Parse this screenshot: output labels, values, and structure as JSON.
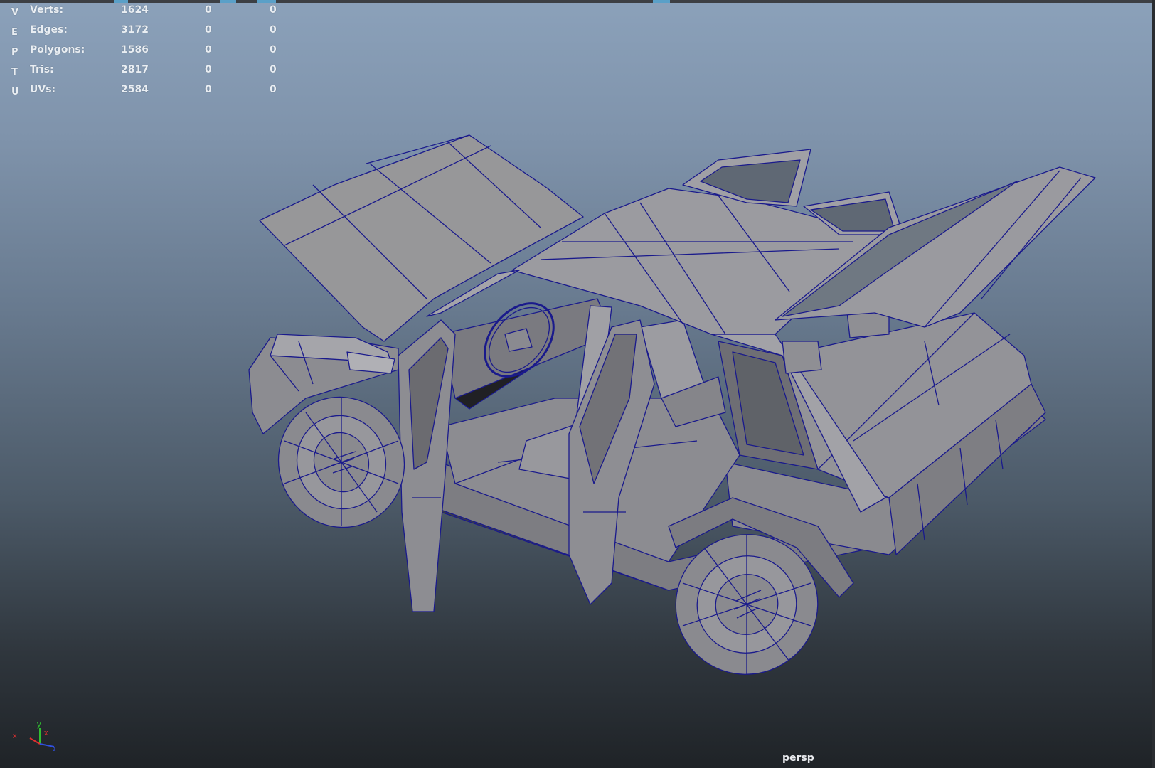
{
  "hud": {
    "rows": [
      {
        "key": "V",
        "label": "Verts:",
        "total": "1624",
        "selected": "0",
        "component": "0"
      },
      {
        "key": "E",
        "label": "Edges:",
        "total": "3172",
        "selected": "0",
        "component": "0"
      },
      {
        "key": "P",
        "label": "Polygons:",
        "total": "1586",
        "selected": "0",
        "component": "0"
      },
      {
        "key": "T",
        "label": "Tris:",
        "total": "2817",
        "selected": "0",
        "component": "0"
      },
      {
        "key": "U",
        "label": "UVs:",
        "total": "2584",
        "selected": "0",
        "component": "0"
      }
    ]
  },
  "viewport": {
    "camera_label": "persp",
    "mesh_color": "#8f8f94",
    "wire_color": "#1a1a8c"
  },
  "axis_gizmo": {
    "x_label": "x",
    "y_label": "y",
    "z_label": "z",
    "x_color": "#e03030",
    "y_color": "#30c030",
    "z_color": "#3050e0"
  }
}
